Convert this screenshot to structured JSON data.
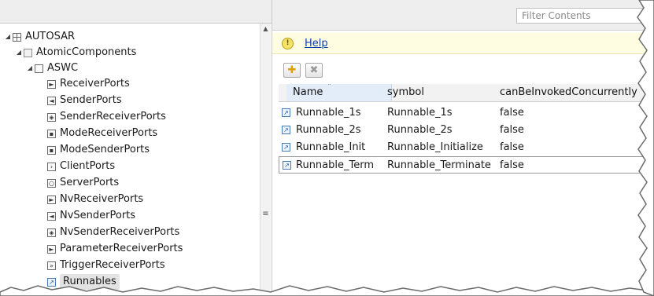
{
  "tree": {
    "root": "AUTOSAR",
    "group": "AtomicComponents",
    "component": "ASWC",
    "items": [
      "ReceiverPorts",
      "SenderPorts",
      "SenderReceiverPorts",
      "ModeReceiverPorts",
      "ModeSenderPorts",
      "ClientPorts",
      "ServerPorts",
      "NvReceiverPorts",
      "NvSenderPorts",
      "NvSenderReceiverPorts",
      "ParameterReceiverPorts",
      "TriggerReceiverPorts",
      "Runnables"
    ],
    "selected": "Runnables"
  },
  "filter": {
    "placeholder": "Filter Contents"
  },
  "help": {
    "label": "Help"
  },
  "table": {
    "columns": [
      "Name",
      "symbol",
      "canBeInvokedConcurrently"
    ],
    "sorted_column": "Name",
    "rows": [
      {
        "name": "Runnable_1s",
        "symbol": "Runnable_1s",
        "concurrent": "false"
      },
      {
        "name": "Runnable_2s",
        "symbol": "Runnable_2s",
        "concurrent": "false"
      },
      {
        "name": "Runnable_Init",
        "symbol": "Runnable_Initialize",
        "concurrent": "false"
      },
      {
        "name": "Runnable_Term",
        "symbol": "Runnable_Terminate",
        "concurrent": "false"
      }
    ],
    "selected_row": "Runnable_Term"
  },
  "colors": {
    "help_bar": "#fefde1",
    "header_bg": "#eeeeee",
    "link": "#0a3fa8",
    "selection": "#e3e3e3"
  }
}
